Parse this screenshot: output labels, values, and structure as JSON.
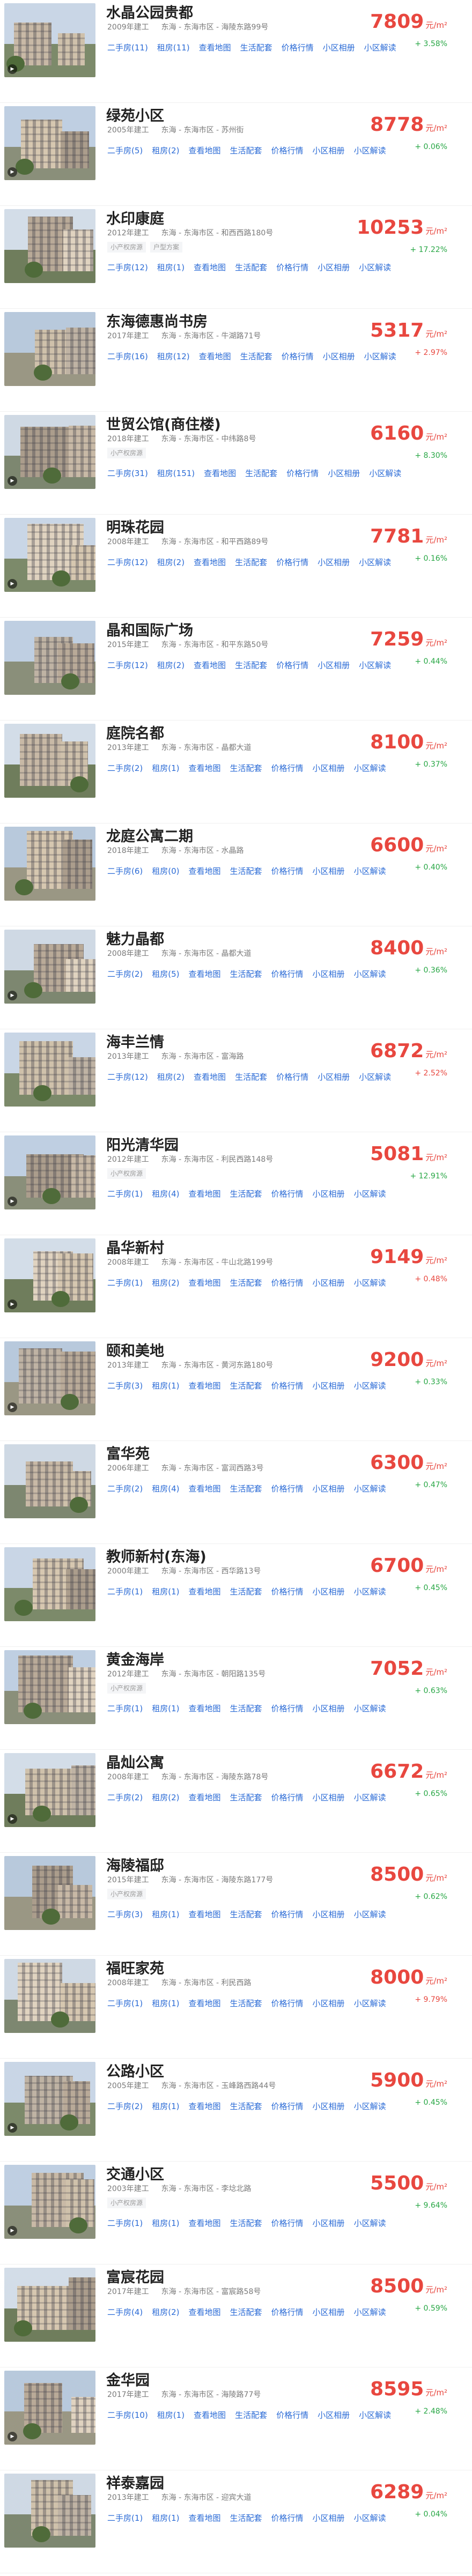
{
  "price_unit": "元/m²",
  "link_labels": [
    "二手房",
    "租房",
    "查看地图",
    "生活配套",
    "价格行情",
    "小区相册",
    "小区解读"
  ],
  "listings": [
    {
      "name": "水晶公园贵都",
      "year": "2009年建工",
      "location": "东海 - 东海市区 - 海陵东路99号",
      "tags": [],
      "secondhand": "二手房(11)",
      "rent": "租房(11)",
      "price": "7809",
      "change": "+ 3.58%",
      "trend": "up"
    },
    {
      "name": "绿苑小区",
      "year": "2005年建工",
      "location": "东海 - 东海市区 - 苏州街",
      "tags": [],
      "secondhand": "二手房(5)",
      "rent": "租房(2)",
      "price": "8778",
      "change": "+ 0.06%",
      "trend": "up"
    },
    {
      "name": "水印康庭",
      "year": "2012年建工",
      "location": "东海 - 东海市区 - 和西西路180号",
      "tags": [
        "小产权房源",
        "户型方案"
      ],
      "secondhand": "二手房(12)",
      "rent": "租房(1)",
      "price": "10253",
      "change": "+ 17.22%",
      "trend": "up"
    },
    {
      "name": "东海德惠尚书房",
      "year": "2017年建工",
      "location": "东海 - 东海市区 - 牛湖路71号",
      "tags": [],
      "secondhand": "二手房(16)",
      "rent": "租房(12)",
      "price": "5317",
      "change": "+ 2.97%",
      "trend": "down"
    },
    {
      "name": "世贸公馆(商住楼)",
      "year": "2018年建工",
      "location": "东海 - 东海市区 - 中纬路8号",
      "tags": [
        "小产权房源"
      ],
      "secondhand": "二手房(31)",
      "rent": "租房(151)",
      "price": "6160",
      "change": "+ 8.30%",
      "trend": "up"
    },
    {
      "name": "明珠花园",
      "year": "2008年建工",
      "location": "东海 - 东海市区 - 和平西路89号",
      "tags": [],
      "secondhand": "二手房(12)",
      "rent": "租房(2)",
      "price": "7781",
      "change": "+ 0.16%",
      "trend": "up"
    },
    {
      "name": "晶和国际广场",
      "year": "2015年建工",
      "location": "东海 - 东海市区 - 和平东路50号",
      "tags": [],
      "secondhand": "二手房(12)",
      "rent": "租房(2)",
      "price": "7259",
      "change": "+ 0.44%",
      "trend": "up"
    },
    {
      "name": "庭院名都",
      "year": "2013年建工",
      "location": "东海 - 东海市区 - 晶都大道",
      "tags": [],
      "secondhand": "二手房(2)",
      "rent": "租房(1)",
      "price": "8100",
      "change": "+ 0.37%",
      "trend": "up"
    },
    {
      "name": "龙庭公寓二期",
      "year": "2018年建工",
      "location": "东海 - 东海市区 - 水晶路",
      "tags": [],
      "secondhand": "二手房(6)",
      "rent": "租房(0)",
      "price": "6600",
      "change": "+ 0.40%",
      "trend": "up"
    },
    {
      "name": "魅力晶都",
      "year": "2008年建工",
      "location": "东海 - 东海市区 - 晶都大道",
      "tags": [],
      "secondhand": "二手房(2)",
      "rent": "租房(5)",
      "price": "8400",
      "change": "+ 0.36%",
      "trend": "up"
    },
    {
      "name": "海丰兰情",
      "year": "2013年建工",
      "location": "东海 - 东海市区 - 富海路",
      "tags": [],
      "secondhand": "二手房(12)",
      "rent": "租房(2)",
      "price": "6872",
      "change": "+ 2.52%",
      "trend": "down"
    },
    {
      "name": "阳光清华园",
      "year": "2012年建工",
      "location": "东海 - 东海市区 - 利民西路148号",
      "tags": [
        "小产权房源"
      ],
      "secondhand": "二手房(1)",
      "rent": "租房(4)",
      "price": "5081",
      "change": "+ 12.91%",
      "trend": "up"
    },
    {
      "name": "晶华新村",
      "year": "2008年建工",
      "location": "东海 - 东海市区 - 牛山北路199号",
      "tags": [],
      "secondhand": "二手房(1)",
      "rent": "租房(2)",
      "price": "9149",
      "change": "+ 0.48%",
      "trend": "down"
    },
    {
      "name": "颐和美地",
      "year": "2013年建工",
      "location": "东海 - 东海市区 - 黄河东路180号",
      "tags": [],
      "secondhand": "二手房(3)",
      "rent": "租房(1)",
      "price": "9200",
      "change": "+ 0.33%",
      "trend": "up"
    },
    {
      "name": "富华苑",
      "year": "2006年建工",
      "location": "东海 - 东海市区 - 富润西路3号",
      "tags": [],
      "secondhand": "二手房(2)",
      "rent": "租房(4)",
      "price": "6300",
      "change": "+ 0.47%",
      "trend": "up"
    },
    {
      "name": "教师新村(东海)",
      "year": "2000年建工",
      "location": "东海 - 东海市区 - 西华路13号",
      "tags": [],
      "secondhand": "二手房(1)",
      "rent": "租房(1)",
      "price": "6700",
      "change": "+ 0.45%",
      "trend": "up"
    },
    {
      "name": "黄金海岸",
      "year": "2012年建工",
      "location": "东海 - 东海市区 - 朝阳路135号",
      "tags": [
        "小产权房源"
      ],
      "secondhand": "二手房(1)",
      "rent": "租房(1)",
      "price": "7052",
      "change": "+ 0.63%",
      "trend": "up"
    },
    {
      "name": "晶灿公寓",
      "year": "2008年建工",
      "location": "东海 - 东海市区 - 海陵东路78号",
      "tags": [],
      "secondhand": "二手房(2)",
      "rent": "租房(2)",
      "price": "6672",
      "change": "+ 0.65%",
      "trend": "up"
    },
    {
      "name": "海陵福邸",
      "year": "2015年建工",
      "location": "东海 - 东海市区 - 海陵东路177号",
      "tags": [
        "小产权房源"
      ],
      "secondhand": "二手房(3)",
      "rent": "租房(1)",
      "price": "8500",
      "change": "+ 0.62%",
      "trend": "up"
    },
    {
      "name": "福旺家苑",
      "year": "2008年建工",
      "location": "东海 - 东海市区 - 利民西路",
      "tags": [],
      "secondhand": "二手房(1)",
      "rent": "租房(1)",
      "price": "8000",
      "change": "+ 9.79%",
      "trend": "down"
    },
    {
      "name": "公路小区",
      "year": "2005年建工",
      "location": "东海 - 东海市区 - 玉峰路西路44号",
      "tags": [],
      "secondhand": "二手房(2)",
      "rent": "租房(1)",
      "price": "5900",
      "change": "+ 0.45%",
      "trend": "up"
    },
    {
      "name": "交通小区",
      "year": "2003年建工",
      "location": "东海 - 东海市区 - 李埝北路",
      "tags": [
        "小产权房源"
      ],
      "secondhand": "二手房(1)",
      "rent": "租房(1)",
      "price": "5500",
      "change": "+ 9.64%",
      "trend": "up"
    },
    {
      "name": "富宸花园",
      "year": "2017年建工",
      "location": "东海 - 东海市区 - 富宸路58号",
      "tags": [],
      "secondhand": "二手房(4)",
      "rent": "租房(2)",
      "price": "8500",
      "change": "+ 0.59%",
      "trend": "up"
    },
    {
      "name": "金华园",
      "year": "2017年建工",
      "location": "东海 - 东海市区 - 海陵路77号",
      "tags": [],
      "secondhand": "二手房(10)",
      "rent": "租房(1)",
      "price": "8595",
      "change": "+ 2.48%",
      "trend": "up"
    },
    {
      "name": "祥泰嘉园",
      "year": "2013年建工",
      "location": "东海 - 东海市区 - 迎宾大道",
      "tags": [],
      "secondhand": "二手房(1)",
      "rent": "租房(1)",
      "price": "6289",
      "change": "+ 0.04%",
      "trend": "up"
    }
  ],
  "colors": {
    "price": "#e8473f",
    "up": "#28a745",
    "down": "#e8473f",
    "link": "#2b6bd6"
  },
  "icons": {
    "video": "play-icon"
  }
}
